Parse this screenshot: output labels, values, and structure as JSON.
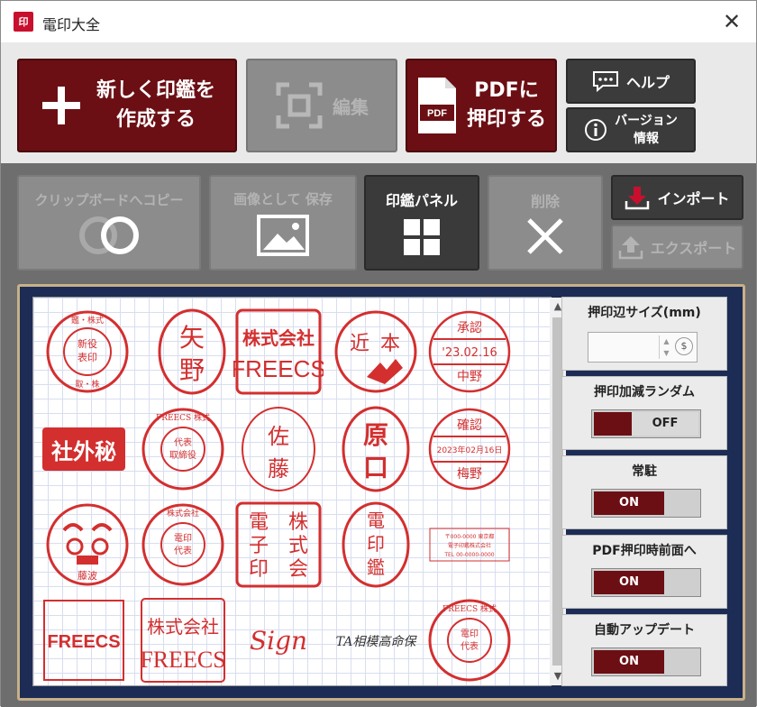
{
  "window": {
    "app_icon": "印",
    "title": "電印大全",
    "close_label": "✕"
  },
  "toolbar1": {
    "new_seal": {
      "line1": "新しく印鑑を",
      "line2": "作成する"
    },
    "edit": {
      "label": "編集"
    },
    "pdf_stamp": {
      "line1": "PDFに",
      "line2": "押印する",
      "doc_label": "PDF"
    },
    "help": {
      "label": "ヘルプ"
    },
    "version": {
      "line1": "バージョン",
      "line2": "情報"
    }
  },
  "toolbar2": {
    "copy_clipboard": "クリップボードへコピー",
    "save_image": "画像として 保存",
    "seal_panel": "印鑑パネル",
    "delete": "削除",
    "import": "インポート",
    "export": "エクスポート"
  },
  "stamps": [
    {
      "type": "round-multi",
      "text": "鑑・株式 新役表印取・株",
      "color": "#d32f2f"
    },
    {
      "type": "oval",
      "text": "矢野",
      "color": "#d32f2f"
    },
    {
      "type": "square",
      "line1": "株式会社",
      "line2": "FREECS",
      "color": "#d32f2f"
    },
    {
      "type": "round-art",
      "text": "近本",
      "color": "#d32f2f"
    },
    {
      "type": "date",
      "top": "承認",
      "date": "'23.02.16",
      "bottom": "中野",
      "color": "#d32f2f"
    },
    {
      "type": "solid-rect",
      "text": "社外秘",
      "color": "#d32f2f"
    },
    {
      "type": "round-multi",
      "text": "FREECS 株式 代表取締役",
      "color": "#d32f2f"
    },
    {
      "type": "oval",
      "text": "佐藤",
      "color": "#d32f2f"
    },
    {
      "type": "oval",
      "text": "原口",
      "color": "#d32f2f"
    },
    {
      "type": "date",
      "top": "確認",
      "date": "2023年02月16日",
      "bottom": "梅野",
      "color": "#d32f2f"
    },
    {
      "type": "round-art",
      "text": "藤波",
      "color": "#d32f2f"
    },
    {
      "type": "round-multi",
      "text": "電印 代表 印",
      "color": "#d32f2f"
    },
    {
      "type": "square",
      "line1": "電子印鑑",
      "line2": "株式会社",
      "color": "#d32f2f"
    },
    {
      "type": "oval",
      "text": "電印",
      "color": "#d32f2f"
    },
    {
      "type": "address",
      "text": "〒000-0000 東京都 電子印鑑株式会社",
      "color": "#d32f2f"
    },
    {
      "type": "rect-text",
      "text": "FREECS",
      "color": "#d32f2f"
    },
    {
      "type": "square",
      "line1": "株式会社",
      "line2": "FREECS",
      "color": "#d32f2f"
    },
    {
      "type": "script",
      "text": "Sign",
      "color": "#d32f2f"
    },
    {
      "type": "script-dark",
      "text": "TA相模高命保",
      "color": "#333333"
    },
    {
      "type": "round-multi",
      "text": "FREECS 株式 電印",
      "color": "#d32f2f"
    }
  ],
  "settings": {
    "stamp_size": {
      "label": "押印辺サイズ(mm)",
      "value": ""
    },
    "random": {
      "label": "押印加減ランダム",
      "state": "OFF"
    },
    "resident": {
      "label": "常駐",
      "state": "ON"
    },
    "pdf_front": {
      "label": "PDF押印時前面へ",
      "state": "ON"
    },
    "auto_update": {
      "label": "自動アップデート",
      "state": "ON"
    }
  },
  "colors": {
    "accent": "#6b0f14",
    "stamp_red": "#d32f2f",
    "panel_navy": "#1c2c55",
    "frame_tan": "#c8b088"
  }
}
